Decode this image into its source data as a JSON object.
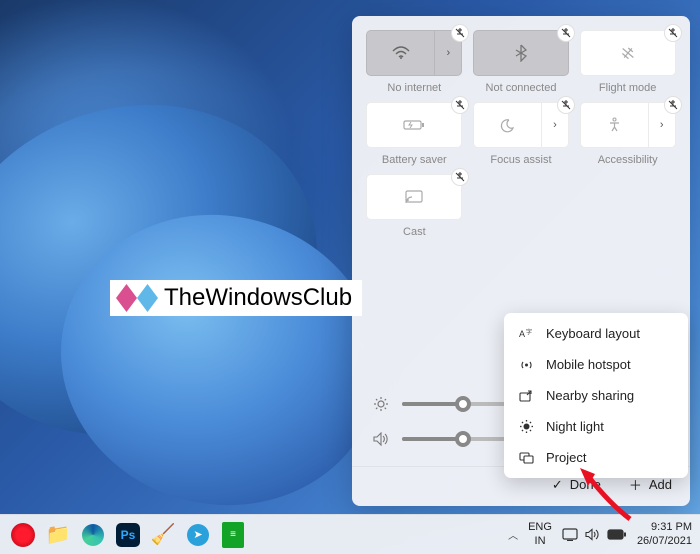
{
  "watermark": {
    "text": "TheWindowsClub"
  },
  "panel": {
    "tiles": [
      {
        "id": "wifi",
        "label": "No internet",
        "active": true,
        "split": true
      },
      {
        "id": "bluetooth",
        "label": "Not connected",
        "active": true
      },
      {
        "id": "flight",
        "label": "Flight mode",
        "active": false
      },
      {
        "id": "battery",
        "label": "Battery saver",
        "active": false
      },
      {
        "id": "focus",
        "label": "Focus assist",
        "active": false,
        "split_chev": true
      },
      {
        "id": "accessibility",
        "label": "Accessibility",
        "active": false,
        "split_chev": true
      },
      {
        "id": "cast",
        "label": "Cast",
        "active": false
      }
    ],
    "brightness": 25,
    "volume": 25,
    "actions": {
      "done": "Done",
      "add": "Add"
    }
  },
  "add_menu": {
    "items": [
      {
        "id": "keyboard",
        "label": "Keyboard layout"
      },
      {
        "id": "hotspot",
        "label": "Mobile hotspot"
      },
      {
        "id": "nearby",
        "label": "Nearby sharing"
      },
      {
        "id": "nightlight",
        "label": "Night light"
      },
      {
        "id": "project",
        "label": "Project"
      }
    ]
  },
  "taskbar": {
    "lang1": "ENG",
    "lang2": "IN",
    "time": "9:31 PM",
    "date": "26/07/2021"
  }
}
